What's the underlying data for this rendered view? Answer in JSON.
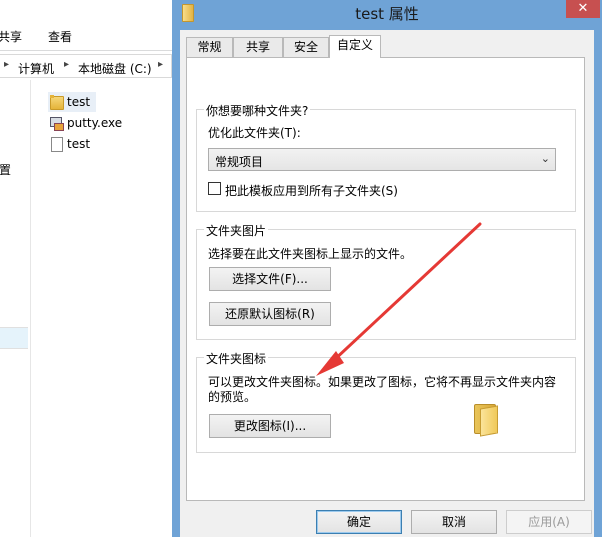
{
  "explorer": {
    "ribbon_tabs": [
      "共享",
      "查看"
    ],
    "breadcrumb": [
      "计算机",
      "本地磁盘 (C:)"
    ],
    "nav_fragment": "置",
    "files": [
      {
        "name": "test",
        "icon": "folder-icon"
      },
      {
        "name": "putty.exe",
        "icon": "putty-icon"
      },
      {
        "name": "test",
        "icon": "file-icon"
      }
    ]
  },
  "dialog": {
    "title": "test 属性",
    "close_glyph": "✕",
    "tabs": [
      "常规",
      "共享",
      "安全",
      "自定义"
    ],
    "active_tab": "自定义",
    "folder_type": {
      "group_title": "你想要哪种文件夹?",
      "optimize_label": "优化此文件夹(T):",
      "selected_option": "常规项目",
      "apply_subfolders_label": "把此模板应用到所有子文件夹(S)",
      "apply_subfolders_checked": false
    },
    "folder_pictures": {
      "group_title": "文件夹图片",
      "description": "选择要在此文件夹图标上显示的文件。",
      "choose_file_button": "选择文件(F)...",
      "restore_default_button": "还原默认图标(R)"
    },
    "folder_icons": {
      "group_title": "文件夹图标",
      "description_line1": "可以更改文件夹图标。如果更改了图标，它将不再显示文件夹内容",
      "description_line2": "的预览。",
      "change_icon_button": "更改图标(I)..."
    },
    "footer": {
      "ok": "确定",
      "cancel": "取消",
      "apply": "应用(A)"
    }
  },
  "colors": {
    "window_frame": "#6fa3d6",
    "close_button": "#c75050",
    "annotation_arrow": "#e53935"
  }
}
